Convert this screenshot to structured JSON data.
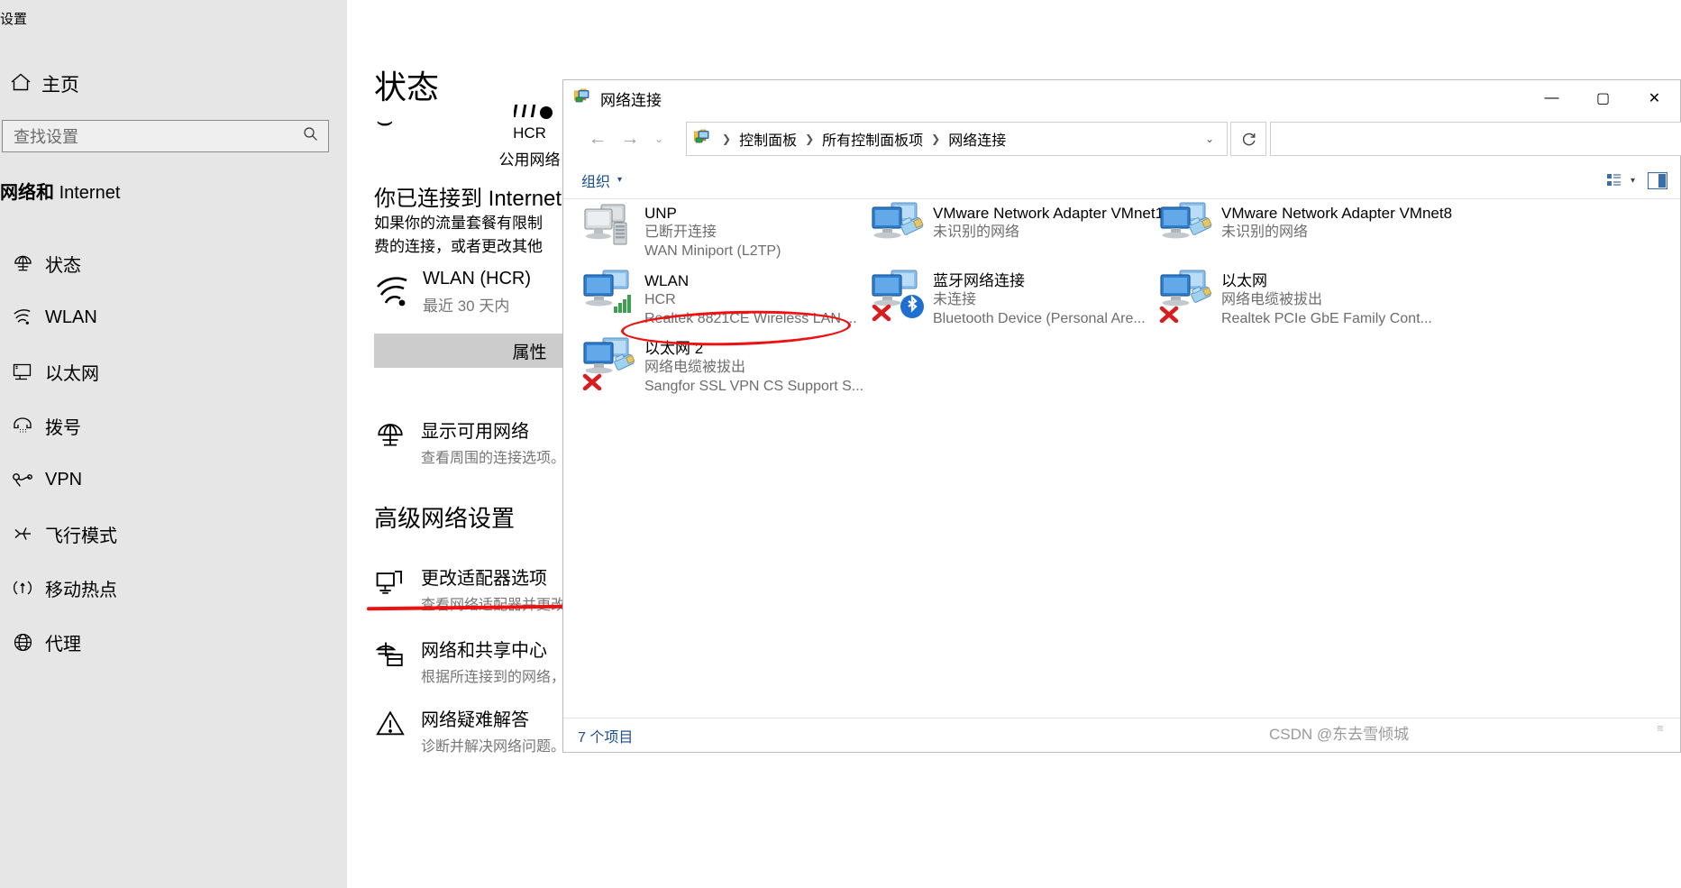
{
  "settings": {
    "window_title": "设置",
    "home_label": "主页",
    "search": {
      "placeholder": "查找设置",
      "icon": "search-icon"
    },
    "section_title_cn": "网络和",
    "section_title_en": "Internet",
    "nav_items": [
      {
        "label": "状态",
        "icon": "globe-status-icon"
      },
      {
        "label": "WLAN",
        "icon": "wifi-icon"
      },
      {
        "label": "以太网",
        "icon": "ethernet-icon"
      },
      {
        "label": "拨号",
        "icon": "dialup-icon"
      },
      {
        "label": "VPN",
        "icon": "vpn-icon"
      },
      {
        "label": "飞行模式",
        "icon": "airplane-icon"
      },
      {
        "label": "移动热点",
        "icon": "hotspot-icon"
      },
      {
        "label": "代理",
        "icon": "proxy-globe-icon"
      }
    ],
    "main": {
      "heading": "状态",
      "heading_underline": "⌣",
      "network_name": "HCR",
      "network_type": "公用网络",
      "connected_title": "你已连接到 Internet",
      "connected_desc_line1": "如果你的流量套餐有限制",
      "connected_desc_line2": "费的连接，或者更改其他",
      "wlan_title": "WLAN (HCR)",
      "wlan_sub": "最近 30 天内",
      "properties_button": "属性",
      "show_networks_title": "显示可用网络",
      "show_networks_sub": "查看周围的连接选项。",
      "advanced_heading": "高级网络设置",
      "change_adapter_title": "更改适配器选项",
      "change_adapter_sub": "查看网络适配器并更改",
      "sharing_center_title": "网络和共享中心",
      "sharing_center_sub": "根据所连接到的网络，",
      "troubleshoot_title": "网络疑难解答",
      "troubleshoot_sub": "诊断并解决网络问题。"
    }
  },
  "netconn": {
    "title": "网络连接",
    "window_buttons": {
      "minimize": "—",
      "maximize": "▢",
      "close": "✕"
    },
    "nav": {
      "back": "←",
      "forward": "→",
      "history": "⌄",
      "up": "↑"
    },
    "breadcrumbs": [
      "控制面板",
      "所有控制面板项",
      "网络连接"
    ],
    "breadcrumb_sep": "❯",
    "address_chevron": "⌄",
    "refresh_icon": "refresh-icon",
    "toolbar": {
      "organize": "组织",
      "organize_chevron": "▾"
    },
    "connections": [
      {
        "name": "UNP",
        "status": "已断开连接",
        "device": "WAN Miniport (L2TP)",
        "icon": "disconnected-dialup-icon",
        "col": 0,
        "row": 0
      },
      {
        "name": "WLAN",
        "status": "HCR",
        "device": "Realtek 8821CE Wireless LAN ...",
        "icon": "wireless-connected-icon",
        "col": 0,
        "row": 1
      },
      {
        "name": "以太网 2",
        "status": "网络电缆被拔出",
        "device": "Sangfor SSL VPN CS Support S...",
        "icon": "ethernet-unplugged-icon",
        "col": 0,
        "row": 2
      },
      {
        "name": "VMware Network Adapter VMnet1",
        "status": "未识别的网络",
        "device": "",
        "icon": "vmware-adapter-icon",
        "col": 1,
        "row": 0
      },
      {
        "name": "蓝牙网络连接",
        "status": "未连接",
        "device": "Bluetooth Device (Personal Are...",
        "icon": "bluetooth-disconnected-icon",
        "col": 1,
        "row": 1
      },
      {
        "name": "VMware Network Adapter VMnet8",
        "status": "未识别的网络",
        "device": "",
        "icon": "vmware-adapter-icon",
        "col": 2,
        "row": 0
      },
      {
        "name": "以太网",
        "status": "网络电缆被拔出",
        "device": "Realtek PCIe GbE Family Cont...",
        "icon": "ethernet-unplugged-icon",
        "col": 2,
        "row": 1
      }
    ],
    "status_count": "7 个项目"
  },
  "watermark": "CSDN @东去雪倾城",
  "colors": {
    "sidebar_bg": "#e6e6e6",
    "accent_link": "#1a4f8a",
    "annotation_red": "#ef1111",
    "muted_text": "#6d6d6d"
  }
}
